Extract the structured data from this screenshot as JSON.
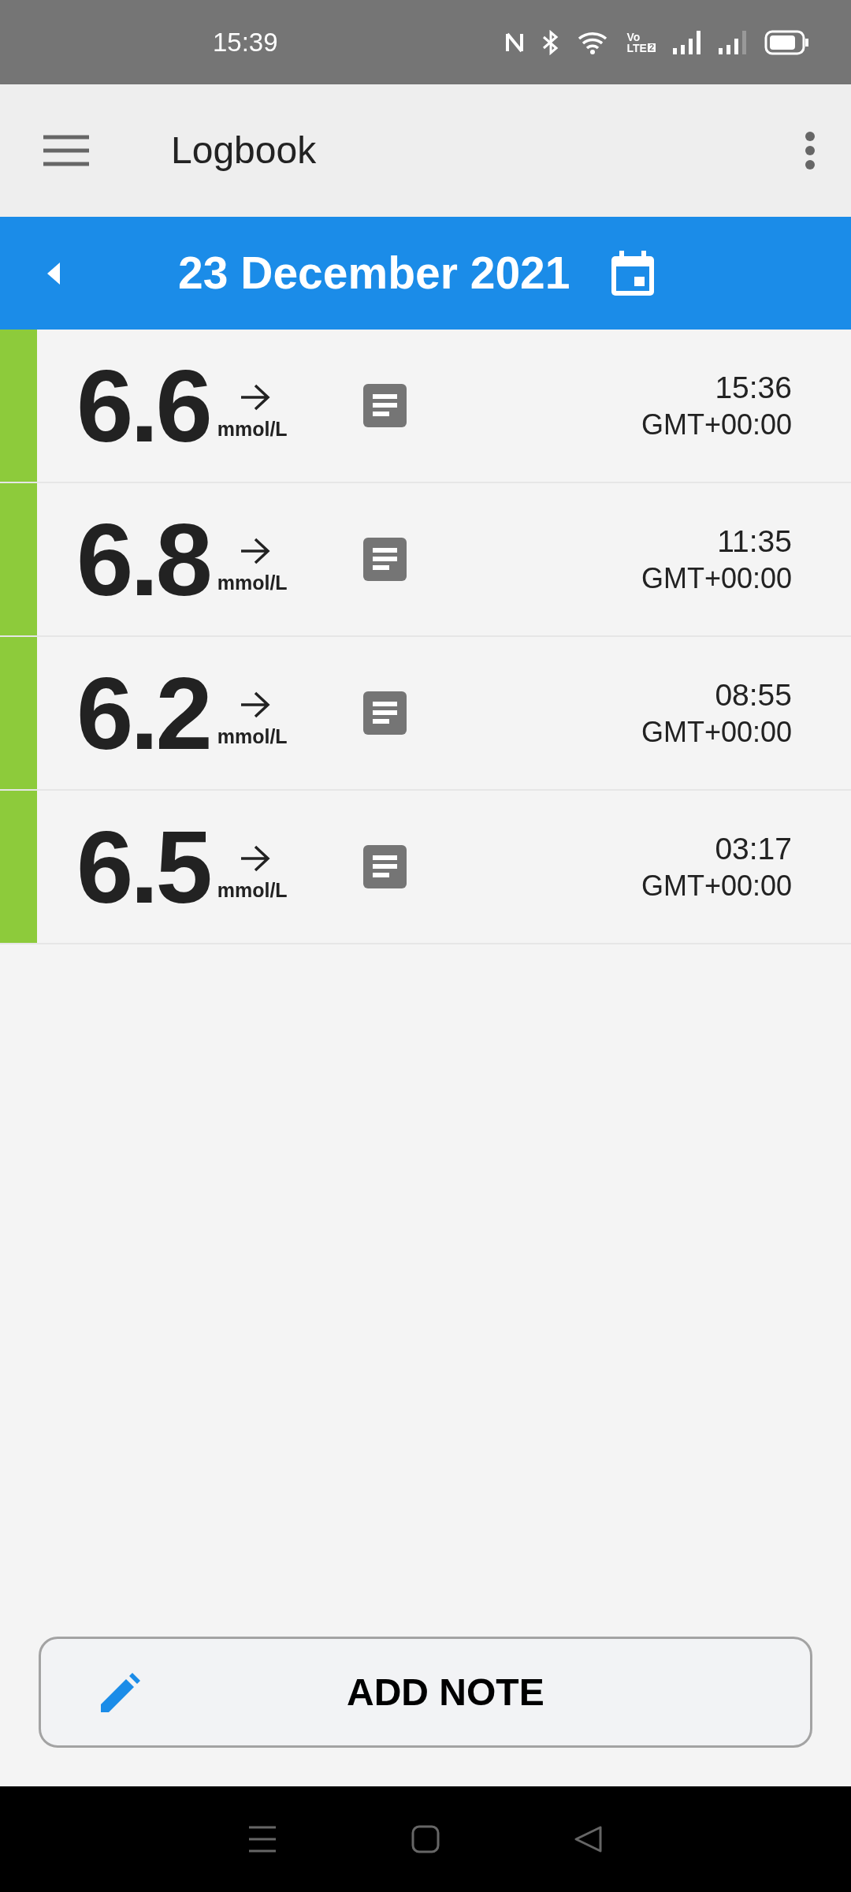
{
  "status_bar": {
    "time": "15:39",
    "volte_top": "Vo",
    "volte_bottom": "LTE",
    "volte_sim": "2"
  },
  "app_bar": {
    "title": "Logbook"
  },
  "date_bar": {
    "date": "23 December 2021"
  },
  "readings": [
    {
      "value": "6.6",
      "unit": "mmol/L",
      "time": "15:36",
      "timezone": "GMT+00:00",
      "color": "#8dcb3b"
    },
    {
      "value": "6.8",
      "unit": "mmol/L",
      "time": "11:35",
      "timezone": "GMT+00:00",
      "color": "#8dcb3b"
    },
    {
      "value": "6.2",
      "unit": "mmol/L",
      "time": "08:55",
      "timezone": "GMT+00:00",
      "color": "#8dcb3b"
    },
    {
      "value": "6.5",
      "unit": "mmol/L",
      "time": "03:17",
      "timezone": "GMT+00:00",
      "color": "#8dcb3b"
    }
  ],
  "add_note_button": {
    "label": "ADD NOTE"
  }
}
